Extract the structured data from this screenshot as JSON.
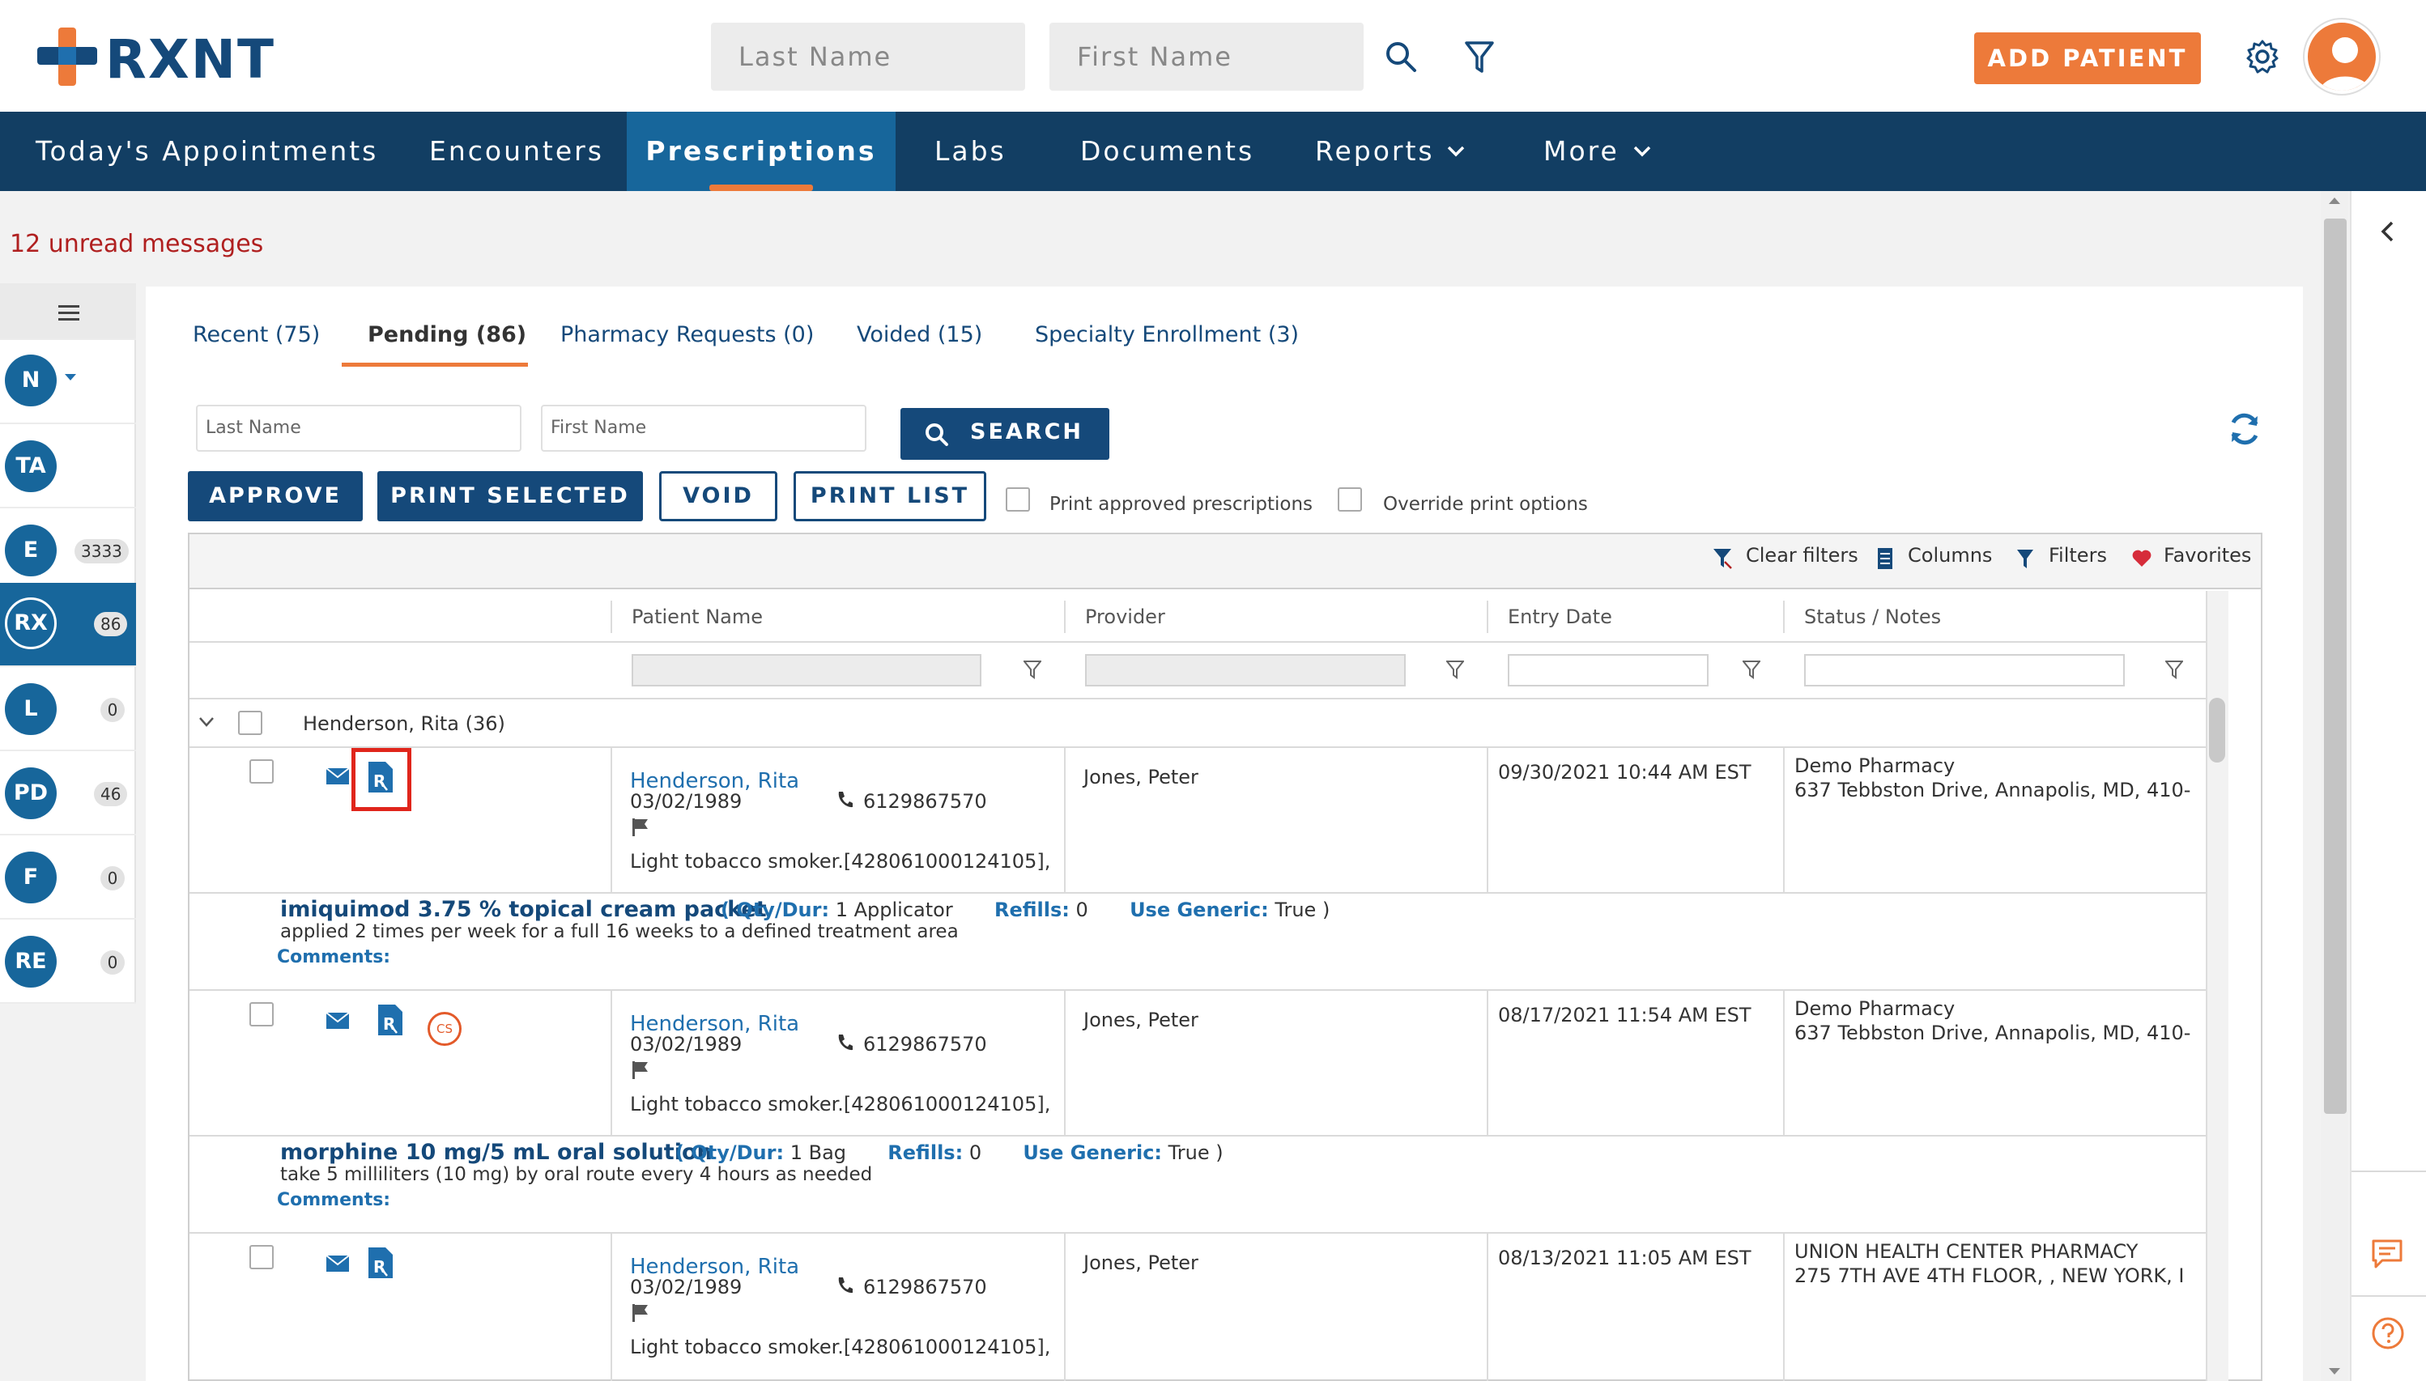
{
  "app": {
    "logo_text": "RXNT",
    "colors": {
      "brand_blue": "#15497a",
      "accent_orange": "#ed7a3a",
      "nav_bg": "#123e63",
      "nav_active": "#17669b",
      "alert_red": "#b02020"
    }
  },
  "header": {
    "last_name_placeholder": "Last Name",
    "first_name_placeholder": "First Name",
    "add_patient_label": "ADD PATIENT",
    "icons": [
      "search-icon",
      "filter-icon",
      "gear-icon",
      "user-avatar"
    ]
  },
  "nav": {
    "items": [
      {
        "label": "Today's Appointments"
      },
      {
        "label": "Encounters"
      },
      {
        "label": "Prescriptions",
        "active": true
      },
      {
        "label": "Labs"
      },
      {
        "label": "Documents"
      },
      {
        "label": "Reports",
        "has_dropdown": true
      },
      {
        "label": "More",
        "has_dropdown": true
      }
    ]
  },
  "messages": {
    "unread_text": "12 unread messages"
  },
  "sidebar": {
    "items": [
      {
        "initials": "N",
        "badge": ""
      },
      {
        "initials": "TA",
        "badge": ""
      },
      {
        "initials": "E",
        "badge": "3333"
      },
      {
        "initials": "RX",
        "badge": "86",
        "active": true
      },
      {
        "initials": "L",
        "badge": "0"
      },
      {
        "initials": "PD",
        "badge": "46"
      },
      {
        "initials": "F",
        "badge": "0"
      },
      {
        "initials": "RE",
        "badge": "0"
      }
    ]
  },
  "tabs": [
    {
      "label": "Recent (75)"
    },
    {
      "label": "Pending (86)",
      "active": true
    },
    {
      "label": "Pharmacy Requests (0)"
    },
    {
      "label": "Voided (15)"
    },
    {
      "label": "Specialty Enrollment (3)"
    }
  ],
  "filters": {
    "last_name_placeholder": "Last Name",
    "first_name_placeholder": "First Name",
    "search_label": "SEARCH"
  },
  "actions": {
    "approve": "APPROVE",
    "print_selected": "PRINT SELECTED",
    "void": "VOID",
    "print_list": "PRINT LIST",
    "print_approved_label": "Print approved prescriptions",
    "override_print_label": "Override print options"
  },
  "grid_toolbar": {
    "clear_filters": "Clear filters",
    "columns": "Columns",
    "filters": "Filters",
    "favorites": "Favorites"
  },
  "columns": [
    "Patient Name",
    "Provider",
    "Entry Date",
    "Status / Notes"
  ],
  "group": {
    "label": "Henderson, Rita (36)"
  },
  "rows": [
    {
      "patient": "Henderson, Rita",
      "dob": "03/02/1989",
      "phone": "6129867570",
      "note": "Light tobacco smoker.[428061000124105],",
      "provider": "Jones, Peter",
      "entry_date": "09/30/2021 10:44 AM EST",
      "pharmacy_name": "Demo Pharmacy",
      "pharmacy_address": "637 Tebbston Drive, Annapolis, MD, 410-",
      "cs": false,
      "rx_highlighted": true,
      "drug": "imiquimod 3.75 % topical cream packet",
      "qty_label": "( Qty/Dur:",
      "qty": "1 Applicator",
      "refills_label": "Refills:",
      "refills": "0",
      "generic_label": "Use Generic:",
      "generic": "True )",
      "sig": "applied 2 times per week for a full 16 weeks to a defined treatment area",
      "comments": "Comments:"
    },
    {
      "patient": "Henderson, Rita",
      "dob": "03/02/1989",
      "phone": "6129867570",
      "note": "Light tobacco smoker.[428061000124105],",
      "provider": "Jones, Peter",
      "entry_date": "08/17/2021 11:54 AM EST",
      "pharmacy_name": "Demo Pharmacy",
      "pharmacy_address": "637 Tebbston Drive, Annapolis, MD, 410-",
      "cs": true,
      "cs_label": "CS",
      "rx_highlighted": false,
      "drug": "morphine 10 mg/5 mL oral solution",
      "qty_label": "( Qty/Dur:",
      "qty": "1 Bag",
      "refills_label": "Refills:",
      "refills": "0",
      "generic_label": "Use Generic:",
      "generic": "True )",
      "sig": "take 5 milliliters (10 mg) by oral route every 4 hours as needed",
      "comments": "Comments:"
    },
    {
      "patient": "Henderson, Rita",
      "dob": "03/02/1989",
      "phone": "6129867570",
      "note": "Light tobacco smoker.[428061000124105],",
      "provider": "Jones, Peter",
      "entry_date": "08/13/2021 11:05 AM EST",
      "pharmacy_name": "UNION HEALTH CENTER PHARMACY",
      "pharmacy_address": "275 7TH AVE 4TH FLOOR, , NEW YORK, I",
      "cs": false,
      "rx_highlighted": false
    }
  ]
}
